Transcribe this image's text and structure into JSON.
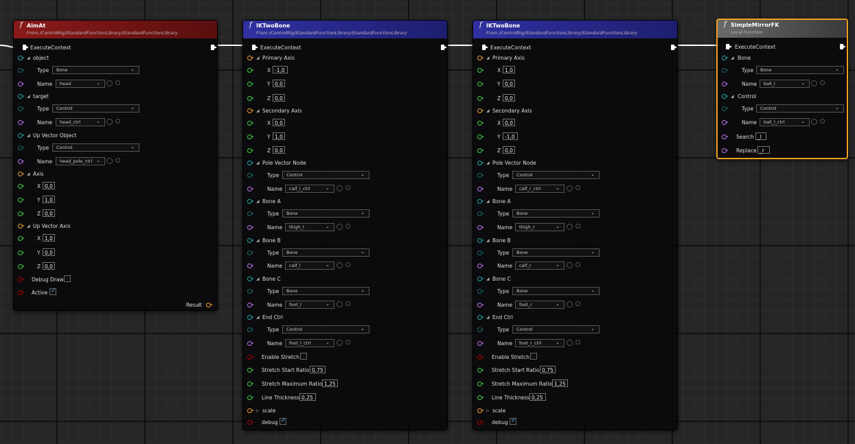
{
  "colors": {
    "exec": "#ffffff",
    "struct_pin": "#f0a030",
    "name_pin": "#c070f0",
    "type_pin": "#20a8a8",
    "float_pin": "#40d040",
    "bool_pin": "#b00000",
    "aimat_header": "#7a1515",
    "iktwobone_header": "#25258a",
    "local_fn_header": "#555555"
  },
  "nodes": {
    "aimat": {
      "title": "AimAt",
      "subtitle": "From /ControlRig/StandardFunctionLibrary/StandardFunctionLibrary",
      "exec_label": "ExecuteContext",
      "object_label": "object",
      "object_type_label": "Type",
      "object_type_value": "Bone",
      "object_name_label": "Name",
      "object_name_value": "head",
      "target_label": "target",
      "target_type_label": "Type",
      "target_type_value": "Control",
      "target_name_label": "Name",
      "target_name_value": "head_ctrl",
      "upobj_label": "Up Vector Object",
      "upobj_type_label": "Type",
      "upobj_type_value": "Control",
      "upobj_name_label": "Name",
      "upobj_name_value": "head_pole_ctrl",
      "axis_label": "Axis",
      "axis_x_label": "X",
      "axis_x": "0,0",
      "axis_y_label": "Y",
      "axis_y": "1,0",
      "axis_z_label": "Z",
      "axis_z": "0,0",
      "upaxis_label": "Up Vector Axis",
      "upaxis_x_label": "X",
      "upaxis_x": "1,0",
      "upaxis_y_label": "Y",
      "upaxis_y": "0,0",
      "upaxis_z_label": "Z",
      "upaxis_z": "0,0",
      "debug_label": "Debug Draw",
      "active_label": "Active",
      "result_label": "Result"
    },
    "ik_left": {
      "title": "IKTwoBone",
      "subtitle": "From /ControlRig/StandardFunctionLibrary/StandardFunctionLibrary",
      "exec_label": "ExecuteContext",
      "primary_label": "Primary Axis",
      "p_x_label": "X",
      "p_x": "-1,0",
      "p_y_label": "Y",
      "p_y": "0,0",
      "p_z_label": "Z",
      "p_z": "0,0",
      "secondary_label": "Secondary Axis",
      "s_x_label": "X",
      "s_x": "0,0",
      "s_y_label": "Y",
      "s_y": "1,0",
      "s_z_label": "Z",
      "s_z": "0,0",
      "pole_label": "Pole Vector Node",
      "pole_type_label": "Type",
      "pole_type": "Control",
      "pole_name_label": "Name",
      "pole_name": "calf_l_ctrl",
      "boneA_label": "Bone A",
      "boneA_type_label": "Type",
      "boneA_type": "Bone",
      "boneA_name_label": "Name",
      "boneA_name": "thigh_l",
      "boneB_label": "Bone B",
      "boneB_type_label": "Type",
      "boneB_type": "Bone",
      "boneB_name_label": "Name",
      "boneB_name": "calf_l",
      "boneC_label": "Bone C",
      "boneC_type_label": "Type",
      "boneC_type": "Bone",
      "boneC_name_label": "Name",
      "boneC_name": "foot_l",
      "end_label": "End Ctrl",
      "end_type_label": "Type",
      "end_type": "Control",
      "end_name_label": "Name",
      "end_name": "foot_l_ctrl",
      "stretch_label": "Enable Stretch",
      "start_ratio_label": "Stretch Start Ratio",
      "start_ratio": "0,75",
      "max_ratio_label": "Stretch Maximum Ratio",
      "max_ratio": "1,25",
      "thickness_label": "Line Thickness",
      "thickness": "0,25",
      "scale_label": "scale",
      "debug_label": "debug"
    },
    "ik_right": {
      "title": "IKTwoBone",
      "subtitle": "From /ControlRig/StandardFunctionLibrary/StandardFunctionLibrary",
      "exec_label": "ExecuteContext",
      "primary_label": "Primary Axis",
      "p_x_label": "X",
      "p_x": "1,0",
      "p_y_label": "Y",
      "p_y": "0,0",
      "p_z_label": "Z",
      "p_z": "0,0",
      "secondary_label": "Secondary Axis",
      "s_x_label": "X",
      "s_x": "0,0",
      "s_y_label": "Y",
      "s_y": "-1,0",
      "s_z_label": "Z",
      "s_z": "0,0",
      "pole_label": "Pole Vector Node",
      "pole_type_label": "Type",
      "pole_type": "Control",
      "pole_name_label": "Name",
      "pole_name": "calf_r_ctrl",
      "boneA_label": "Bone A",
      "boneA_type_label": "Type",
      "boneA_type": "Bone",
      "boneA_name_label": "Name",
      "boneA_name": "thigh_r",
      "boneB_label": "Bone B",
      "boneB_type_label": "Type",
      "boneB_type": "Bone",
      "boneB_name_label": "Name",
      "boneB_name": "calf_r",
      "boneC_label": "Bone C",
      "boneC_type_label": "Type",
      "boneC_type": "Bone",
      "boneC_name_label": "Name",
      "boneC_name": "foot_r",
      "end_label": "End Ctrl",
      "end_type_label": "Type",
      "end_type": "Control",
      "end_name_label": "Name",
      "end_name": "foot_r_ctrl",
      "stretch_label": "Enable Stretch",
      "start_ratio_label": "Stretch Start Ratio",
      "start_ratio": "0,75",
      "max_ratio_label": "Stretch Maximum Ratio",
      "max_ratio": "1,25",
      "thickness_label": "Line Thickness",
      "thickness": "0,25",
      "scale_label": "scale",
      "debug_label": "debug"
    },
    "mirror": {
      "title": "SimpleMirrorFK",
      "subtitle": "Local Function",
      "exec_label": "ExecuteContext",
      "bone_label": "Bone",
      "bone_type_label": "Type",
      "bone_type": "Bone",
      "bone_name_label": "Name",
      "bone_name": "ball_l",
      "control_label": "Control",
      "control_type_label": "Type",
      "control_type": "Control",
      "control_name_label": "Name",
      "control_name": "ball_l_ctrl",
      "search_label": "Search",
      "search": "_l",
      "replace_label": "Replace",
      "replace": "_r"
    }
  }
}
